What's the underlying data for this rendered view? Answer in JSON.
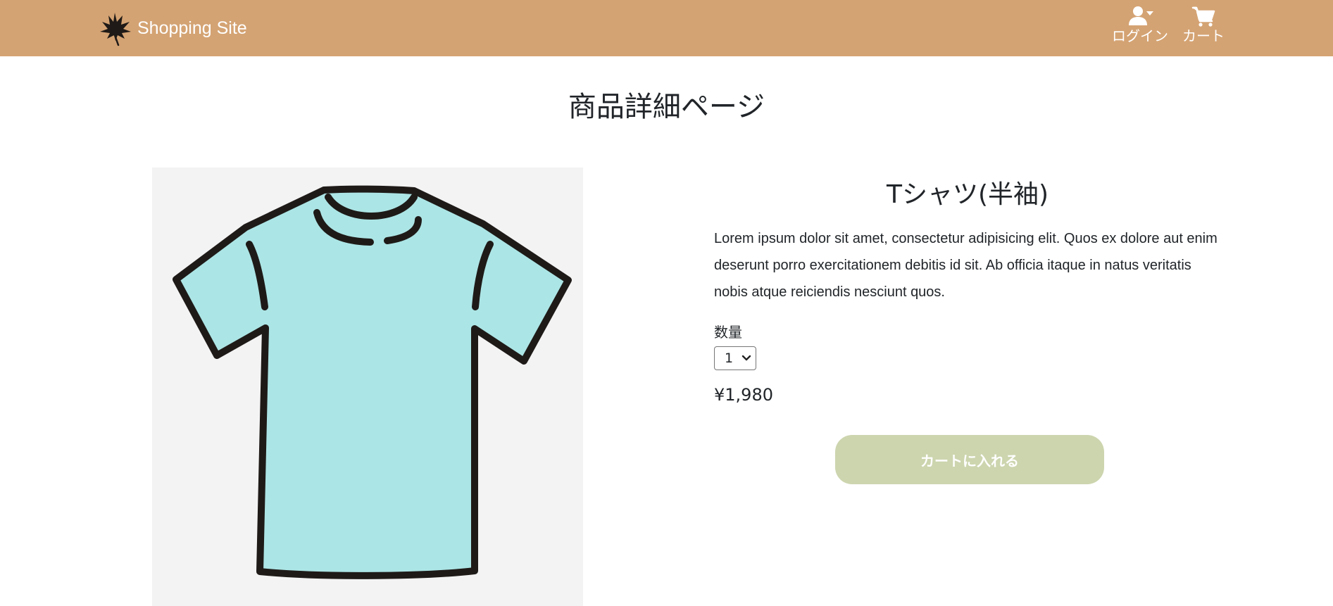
{
  "header": {
    "brand_name": "Shopping Site",
    "brand_icon": "leaf-icon",
    "nav": {
      "login_label": "ログイン",
      "login_icon": "user-dropdown-icon",
      "cart_label": "カート",
      "cart_icon": "shopping-cart-icon"
    },
    "background_color": "#d4a373"
  },
  "main": {
    "page_title": "商品詳細ページ",
    "product": {
      "image_icon": "t-shirt-image",
      "name": "Tシャツ(半袖)",
      "description": "Lorem ipsum dolor sit amet, consectetur adipisicing elit. Quos ex dolore aut enim deserunt porro exercitationem debitis id sit. Ab officia itaque in natus veritatis nobis atque reiciendis nesciunt quos.",
      "quantity_label": "数量",
      "quantity_selected": "1",
      "price": "¥1,980",
      "add_to_cart_label": "カートに入れる",
      "button_color": "#ccd5ae"
    }
  }
}
